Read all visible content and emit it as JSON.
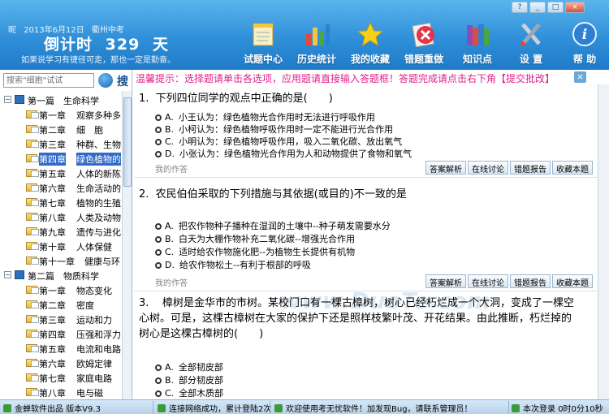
{
  "header": {
    "logo_text": "昵",
    "date": "2013年6月12日",
    "location": "衢州中考",
    "countdown_label": "倒计时",
    "countdown_days": "329",
    "countdown_unit": "天",
    "motto": "如果说学习有捷径可走，那也一定是勤奋。"
  },
  "window_controls": {
    "help": "?",
    "minimize": "_",
    "maximize": "□",
    "close": "×"
  },
  "toolbar": [
    {
      "label": "试题中心",
      "icon": "notebook-icon",
      "color": "#f3c63e"
    },
    {
      "label": "历史统计",
      "icon": "bar-chart-icon",
      "color": "#e24a3b"
    },
    {
      "label": "我的收藏",
      "icon": "star-icon",
      "color": "#f7d117"
    },
    {
      "label": "错题重做",
      "icon": "error-redo-icon",
      "color": "#e3344a"
    },
    {
      "label": "知识点",
      "icon": "books-icon",
      "color": "#8a4db8"
    },
    {
      "label": "设 置",
      "icon": "tools-icon",
      "color": "#9aa8b6"
    },
    {
      "label": "帮 助",
      "icon": "help-icon",
      "color": "#2f7fd2"
    }
  ],
  "search": {
    "placeholder": "搜索\"细胞\"试试",
    "button_label": "搜"
  },
  "tree": [
    {
      "kind": "book",
      "a": "第一篇",
      "b": "生命科学",
      "indent": 0
    },
    {
      "kind": "chapter",
      "a": "第一章",
      "b": "观察多种多",
      "indent": 1
    },
    {
      "kind": "chapter",
      "a": "第二章",
      "b": "细　胞",
      "indent": 1
    },
    {
      "kind": "chapter",
      "a": "第三章",
      "b": "种群、生物",
      "indent": 1
    },
    {
      "kind": "chapter",
      "a": "第四章",
      "b": "绿色植物的",
      "indent": 1,
      "selected": true
    },
    {
      "kind": "chapter",
      "a": "第五章",
      "b": "人体的新陈",
      "indent": 1
    },
    {
      "kind": "chapter",
      "a": "第六章",
      "b": "生命活动的",
      "indent": 1
    },
    {
      "kind": "chapter",
      "a": "第七章",
      "b": "植物的生殖",
      "indent": 1
    },
    {
      "kind": "chapter",
      "a": "第八章",
      "b": "人类及动物",
      "indent": 1
    },
    {
      "kind": "chapter",
      "a": "第九章",
      "b": "遗传与进化",
      "indent": 1
    },
    {
      "kind": "chapter",
      "a": "第十章",
      "b": "人体保健",
      "indent": 1
    },
    {
      "kind": "chapter",
      "a": "第十一章",
      "b": "健康与环",
      "indent": 1
    },
    {
      "kind": "book",
      "a": "第二篇",
      "b": "物质科学",
      "indent": 0
    },
    {
      "kind": "chapter",
      "a": "第一章",
      "b": "物态变化",
      "indent": 1
    },
    {
      "kind": "chapter",
      "a": "第二章",
      "b": "密度",
      "indent": 1
    },
    {
      "kind": "chapter",
      "a": "第三章",
      "b": "运动和力",
      "indent": 1
    },
    {
      "kind": "chapter",
      "a": "第四章",
      "b": "压强和浮力",
      "indent": 1
    },
    {
      "kind": "chapter",
      "a": "第五章",
      "b": "电流和电路",
      "indent": 1
    },
    {
      "kind": "chapter",
      "a": "第六章",
      "b": "欧姆定律",
      "indent": 1
    },
    {
      "kind": "chapter",
      "a": "第七章",
      "b": "家庭电路",
      "indent": 1
    },
    {
      "kind": "chapter",
      "a": "第八章",
      "b": "电与磁",
      "indent": 1
    }
  ],
  "notice": {
    "text": "温馨提示：选择题请单击各选项，应用题请直接输入答题框！答题完成请点击右下角【提交批改】",
    "close_label": "×"
  },
  "actions": {
    "analysis": "答案解析",
    "discuss": "在线讨论",
    "report": "错题报告",
    "favorite": "收藏本题"
  },
  "my_answer_label": "我的作答",
  "questions": [
    {
      "number": "1.",
      "stem": "下列四位同学的观点中正确的是(　　)",
      "options": [
        {
          "letter": "A.",
          "text": "小王认为：绿色植物光合作用时无法进行呼吸作用"
        },
        {
          "letter": "B.",
          "text": "小柯认为：绿色植物呼吸作用时一定不能进行光合作用"
        },
        {
          "letter": "C.",
          "text": "小明认为：绿色植物呼吸作用，吸入二氧化碳、放出氧气"
        },
        {
          "letter": "D.",
          "text": "小张认为：绿色植物光合作用为人和动物提供了食物和氧气"
        }
      ]
    },
    {
      "number": "2.",
      "stem": "农民伯伯采取的下列措施与其依据(或目的)不一致的是",
      "options": [
        {
          "letter": "A.",
          "text": "把农作物种子播种在湿润的土壤中--种子萌发需要水分"
        },
        {
          "letter": "B.",
          "text": "白天为大棚作物补充二氧化碳--增强光合作用"
        },
        {
          "letter": "C.",
          "text": "适时给农作物施化肥--为植物生长提供有机物"
        },
        {
          "letter": "D.",
          "text": "给农作物松土--有利于根部的呼吸"
        }
      ]
    },
    {
      "number": "3.",
      "stem": "樟树是金华市的市树。某校门口有一棵古樟树，树心已经朽烂成一个大洞，变成了一棵空心树。可是，这棵古樟树在大家的保护下还是照样枝繁叶茂、开花结果。由此推断，朽烂掉的树心是这棵古樟树的(　　)",
      "options": [
        {
          "letter": "A.",
          "text": "全部韧皮部"
        },
        {
          "letter": "B.",
          "text": "部分韧皮部"
        },
        {
          "letter": "C.",
          "text": "全部木质部"
        }
      ]
    }
  ],
  "watermark": "www.DuoTe.com",
  "status": {
    "vendor": "金蝉软件出品",
    "version": "版本V9.3",
    "network": "连接网络成功，累计登陆2次",
    "welcome": "欢迎使用考无忧软件！加发现Bug，请联系管理员！",
    "session": "本次登录",
    "progress": "0时0分10秒"
  }
}
